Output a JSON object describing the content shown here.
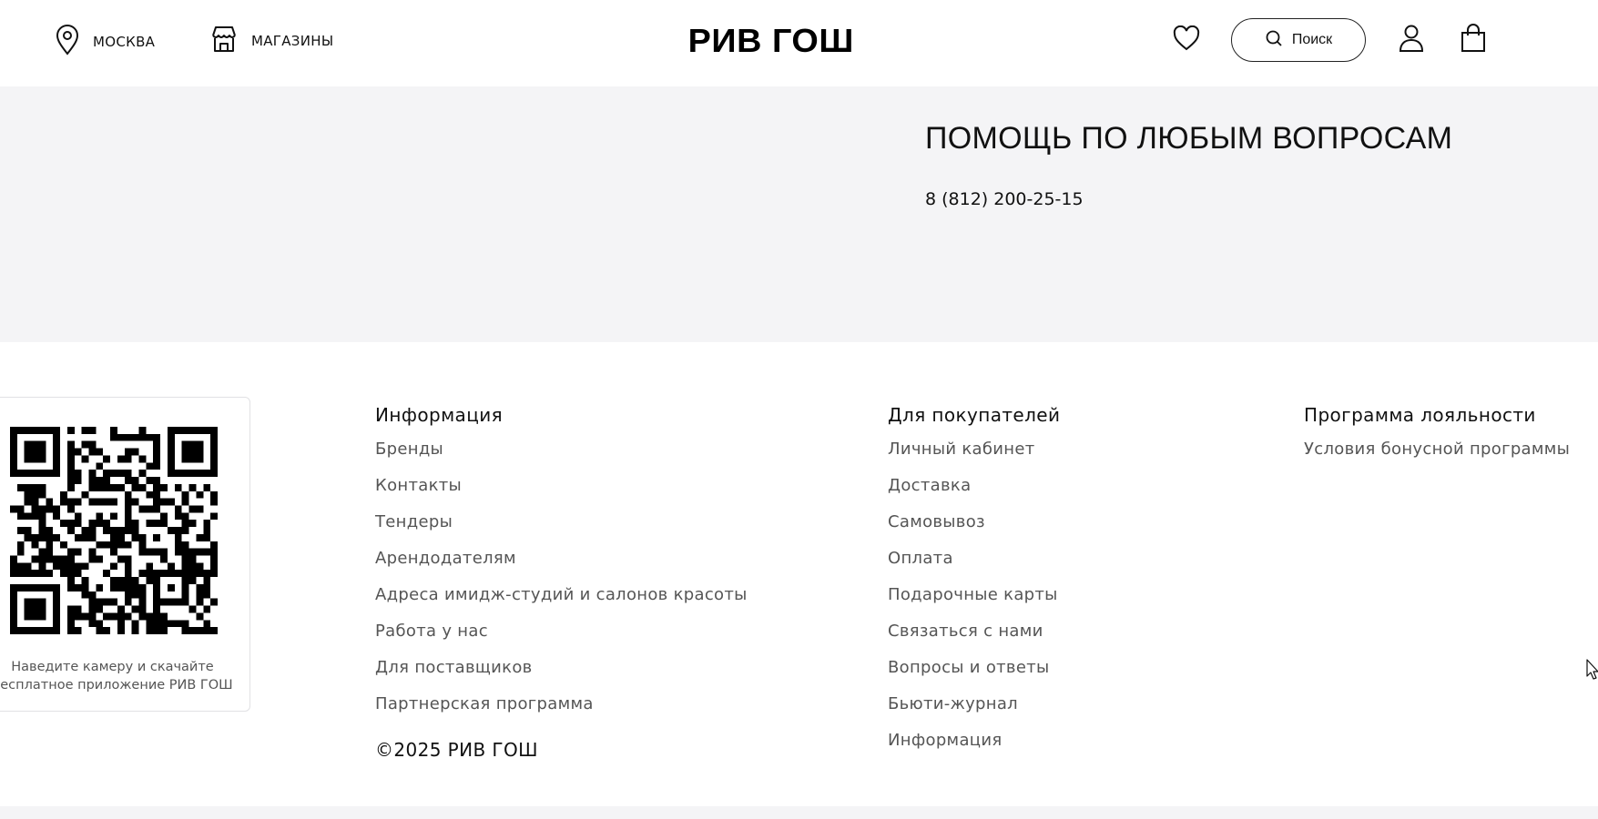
{
  "header": {
    "city_label": "МОСКВА",
    "stores_label": "МАГАЗИНЫ",
    "logo_text": "РИВ ГОШ",
    "search_label": "Поиск",
    "icons": [
      "location-icon",
      "store-icon",
      "heart-icon",
      "search-icon",
      "user-icon",
      "cart-icon"
    ]
  },
  "help": {
    "title": "ПОМОЩЬ ПО ЛЮБЫМ ВОПРОСАМ",
    "phone": "8 (812) 200-25-15"
  },
  "qr": {
    "caption_line1": "Наведите камеру и скачайте",
    "caption_line2": "бесплатное приложение РИВ ГОШ"
  },
  "footer": {
    "columns": [
      {
        "title": "Информация",
        "items": [
          "Бренды",
          "Контакты",
          "Тендеры",
          "Арендодателям",
          "Адреса имидж-студий и салонов красоты",
          "Работа у нас",
          "Для поставщиков",
          "Партнерская программа"
        ]
      },
      {
        "title": "Для покупателей",
        "items": [
          "Личный кабинет",
          "Доставка",
          "Самовывоз",
          "Оплата",
          "Подарочные карты",
          "Связаться с нами",
          "Вопросы и ответы",
          "Бьюти-журнал",
          "Информация"
        ]
      },
      {
        "title": "Программа лояльности",
        "items": [
          "Условия бонусной программы"
        ]
      }
    ],
    "copyright": "©2025 РИВ ГОШ"
  },
  "colors": {
    "background": "#ffffff",
    "band": "#f4f4f6",
    "text": "#111111",
    "link": "#555555"
  }
}
